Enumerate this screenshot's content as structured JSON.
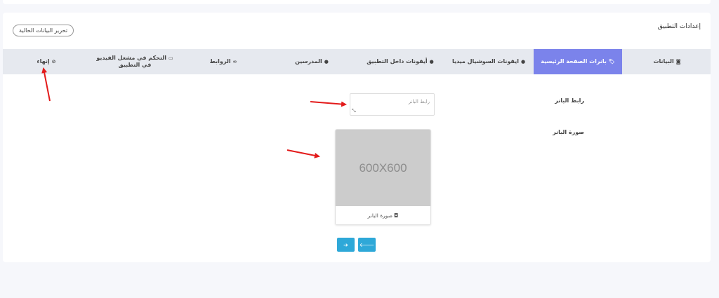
{
  "card": {
    "title": "إعدادات التطبيق",
    "edit_button": "تحرير البيانات الحالية"
  },
  "tabs": [
    {
      "label": "البيانات",
      "icon": "◙"
    },
    {
      "label": "بانرات الصفحة الرئيسية",
      "icon": "🏷"
    },
    {
      "label": "ايقونات السوشيال ميديا",
      "icon": "●"
    },
    {
      "label": "أيقونات داخل التطبيق",
      "icon": "●"
    },
    {
      "label": "المدرسين",
      "icon": "●"
    },
    {
      "label": "الروابط",
      "icon": "∞"
    },
    {
      "label": "التحكم في مشغل الفيديو في التطبيق",
      "icon": "▭"
    },
    {
      "label": "إنهاء",
      "icon": "⊘"
    }
  ],
  "form": {
    "banner_link_label": "رابط البانر",
    "banner_link_placeholder": "رابط البانر",
    "banner_image_label": "صورة البانر",
    "image_placeholder": "600X600",
    "image_caption": "صورة البانر"
  },
  "nav": {
    "next_icon": "➔",
    "prev_icon": "🡐"
  },
  "colors": {
    "active_tab": "#7b83eb",
    "nav_button": "#2ea8d8",
    "annotation_arrow": "#e31b1b"
  }
}
